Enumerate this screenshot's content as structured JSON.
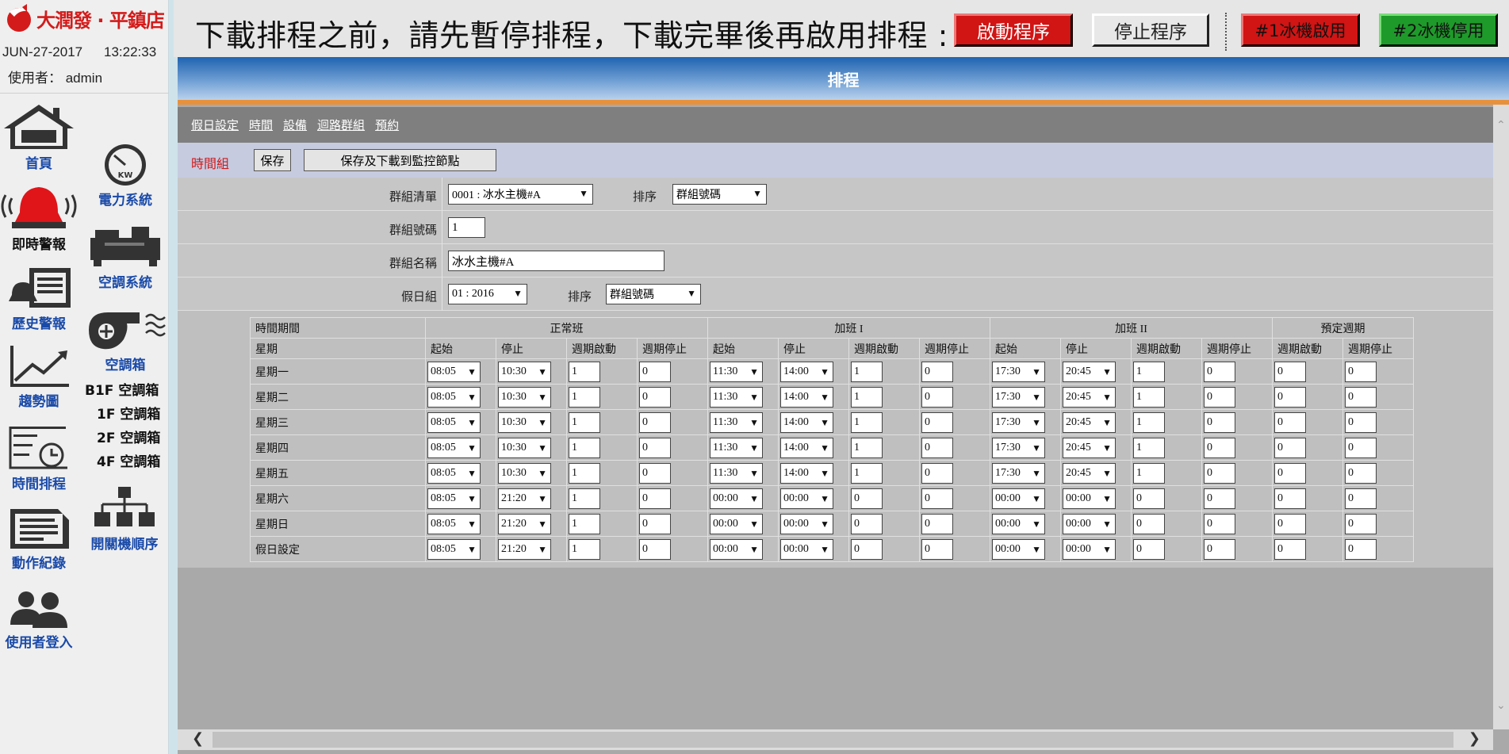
{
  "brand": {
    "name": "大潤發 · 平鎮店"
  },
  "sidebar": {
    "date": "JUN-27-2017",
    "time": "13:22:33",
    "user": "使用者： admin",
    "nav_left": [
      {
        "label": "首頁"
      },
      {
        "label": "即時警報"
      },
      {
        "label": "歷史警報"
      },
      {
        "label": "趨勢圖"
      },
      {
        "label": "時間排程"
      },
      {
        "label": "動作紀錄"
      },
      {
        "label": "使用者登入"
      }
    ],
    "nav_right": [
      {
        "label": "電力系統"
      },
      {
        "label": "空調系統"
      },
      {
        "label": "空調箱"
      },
      {
        "label": "開關機順序"
      }
    ],
    "ac_floors": [
      "B1F 空調箱",
      "1F 空調箱",
      "2F 空調箱",
      "4F 空調箱"
    ]
  },
  "topbar": {
    "notice": "下載排程之前，請先暫停排程，下載完畢後再啟用排程 :",
    "start_label": "啟動程序",
    "stop_label": "停止程序",
    "chiller1_label": "#1冰機啟用",
    "chiller2_label": "#2冰機停用"
  },
  "page_title": "排程",
  "subnav": [
    "假日設定",
    "時間",
    "設備",
    "迴路群組",
    "預約"
  ],
  "toolbar": {
    "title": "時間組",
    "save_label": "保存",
    "save_download_label": "保存及下載到監控節點"
  },
  "form": {
    "group_list_label": "群組清單",
    "group_list_value": "0001 : 冰水主機#A",
    "sort_label": "排序",
    "sort_value": "群組號碼",
    "group_no_label": "群組號碼",
    "group_no_value": "1",
    "group_name_label": "群組名稱",
    "group_name_value": "冰水主機#A",
    "holiday_label": "假日組",
    "holiday_value": "01 : 2016",
    "sort2_label": "排序",
    "sort2_value": "群組號碼"
  },
  "schedule": {
    "period_header": "時間期間",
    "weekday_header": "星期",
    "groups": [
      "正常班",
      "加班 I",
      "加班 II",
      "預定週期"
    ],
    "cols": [
      "起始",
      "停止",
      "週期啟動",
      "週期停止"
    ],
    "cycle_cols": [
      "週期啟動",
      "週期停止"
    ],
    "rows": [
      {
        "day": "星期一",
        "n": [
          "08:05",
          "10:30",
          "1",
          "0"
        ],
        "o1": [
          "11:30",
          "14:00",
          "1",
          "0"
        ],
        "o2": [
          "17:30",
          "20:45",
          "1",
          "0"
        ],
        "c": [
          "0",
          "0"
        ]
      },
      {
        "day": "星期二",
        "n": [
          "08:05",
          "10:30",
          "1",
          "0"
        ],
        "o1": [
          "11:30",
          "14:00",
          "1",
          "0"
        ],
        "o2": [
          "17:30",
          "20:45",
          "1",
          "0"
        ],
        "c": [
          "0",
          "0"
        ]
      },
      {
        "day": "星期三",
        "n": [
          "08:05",
          "10:30",
          "1",
          "0"
        ],
        "o1": [
          "11:30",
          "14:00",
          "1",
          "0"
        ],
        "o2": [
          "17:30",
          "20:45",
          "1",
          "0"
        ],
        "c": [
          "0",
          "0"
        ]
      },
      {
        "day": "星期四",
        "n": [
          "08:05",
          "10:30",
          "1",
          "0"
        ],
        "o1": [
          "11:30",
          "14:00",
          "1",
          "0"
        ],
        "o2": [
          "17:30",
          "20:45",
          "1",
          "0"
        ],
        "c": [
          "0",
          "0"
        ]
      },
      {
        "day": "星期五",
        "n": [
          "08:05",
          "10:30",
          "1",
          "0"
        ],
        "o1": [
          "11:30",
          "14:00",
          "1",
          "0"
        ],
        "o2": [
          "17:30",
          "20:45",
          "1",
          "0"
        ],
        "c": [
          "0",
          "0"
        ]
      },
      {
        "day": "星期六",
        "n": [
          "08:05",
          "21:20",
          "1",
          "0"
        ],
        "o1": [
          "00:00",
          "00:00",
          "0",
          "0"
        ],
        "o2": [
          "00:00",
          "00:00",
          "0",
          "0"
        ],
        "c": [
          "0",
          "0"
        ]
      },
      {
        "day": "星期日",
        "n": [
          "08:05",
          "21:20",
          "1",
          "0"
        ],
        "o1": [
          "00:00",
          "00:00",
          "0",
          "0"
        ],
        "o2": [
          "00:00",
          "00:00",
          "0",
          "0"
        ],
        "c": [
          "0",
          "0"
        ]
      },
      {
        "day": "假日設定",
        "n": [
          "08:05",
          "21:20",
          "1",
          "0"
        ],
        "o1": [
          "00:00",
          "00:00",
          "0",
          "0"
        ],
        "o2": [
          "00:00",
          "00:00",
          "0",
          "0"
        ],
        "c": [
          "0",
          "0"
        ]
      }
    ]
  },
  "colors": {
    "accent_red": "#d11414",
    "accent_green": "#1e9a2a",
    "title_blue": "#1f63b0",
    "nav_blue": "#1a4aa8",
    "orange_line": "#e8913c"
  }
}
